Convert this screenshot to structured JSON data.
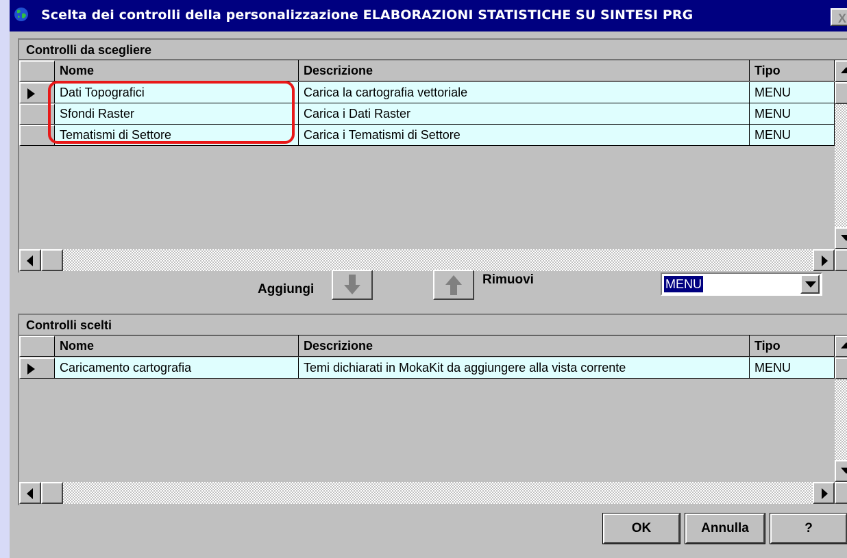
{
  "window": {
    "title": "Scelta dei controlli della personalizzazione  ELABORAZIONI STATISTICHE SU SINTESI PRG",
    "close_label": "X"
  },
  "colors": {
    "title_bar": "#000080",
    "row_background": "#dffefe",
    "highlight_annotation": "#e81818",
    "selection": "#000080"
  },
  "available_panel": {
    "caption": "Controlli da scegliere",
    "columns": [
      "Nome",
      "Descrizione",
      "Tipo"
    ],
    "rows": [
      {
        "nome": "Dati Topografici",
        "descrizione": "Carica la cartografia vettoriale",
        "tipo": "MENU"
      },
      {
        "nome": "Sfondi Raster",
        "descrizione": "Carica i Dati Raster",
        "tipo": "MENU"
      },
      {
        "nome": "Tematismi di Settore",
        "descrizione": "Carica i Tematismi di Settore",
        "tipo": "MENU"
      }
    ]
  },
  "actions": {
    "add_label": "Aggiungi",
    "remove_label": "Rimuovi",
    "add_icon": "arrow-down-icon",
    "remove_icon": "arrow-up-icon",
    "type_filter_value": "MENU"
  },
  "selected_panel": {
    "caption": "Controlli scelti",
    "columns": [
      "Nome",
      "Descrizione",
      "Tipo"
    ],
    "rows": [
      {
        "nome": "Caricamento cartografia",
        "descrizione": "Temi dichiarati in MokaKit da aggiungere alla vista corrente",
        "tipo": "MENU"
      }
    ]
  },
  "buttons": {
    "ok": "OK",
    "cancel": "Annulla",
    "help": "?"
  }
}
